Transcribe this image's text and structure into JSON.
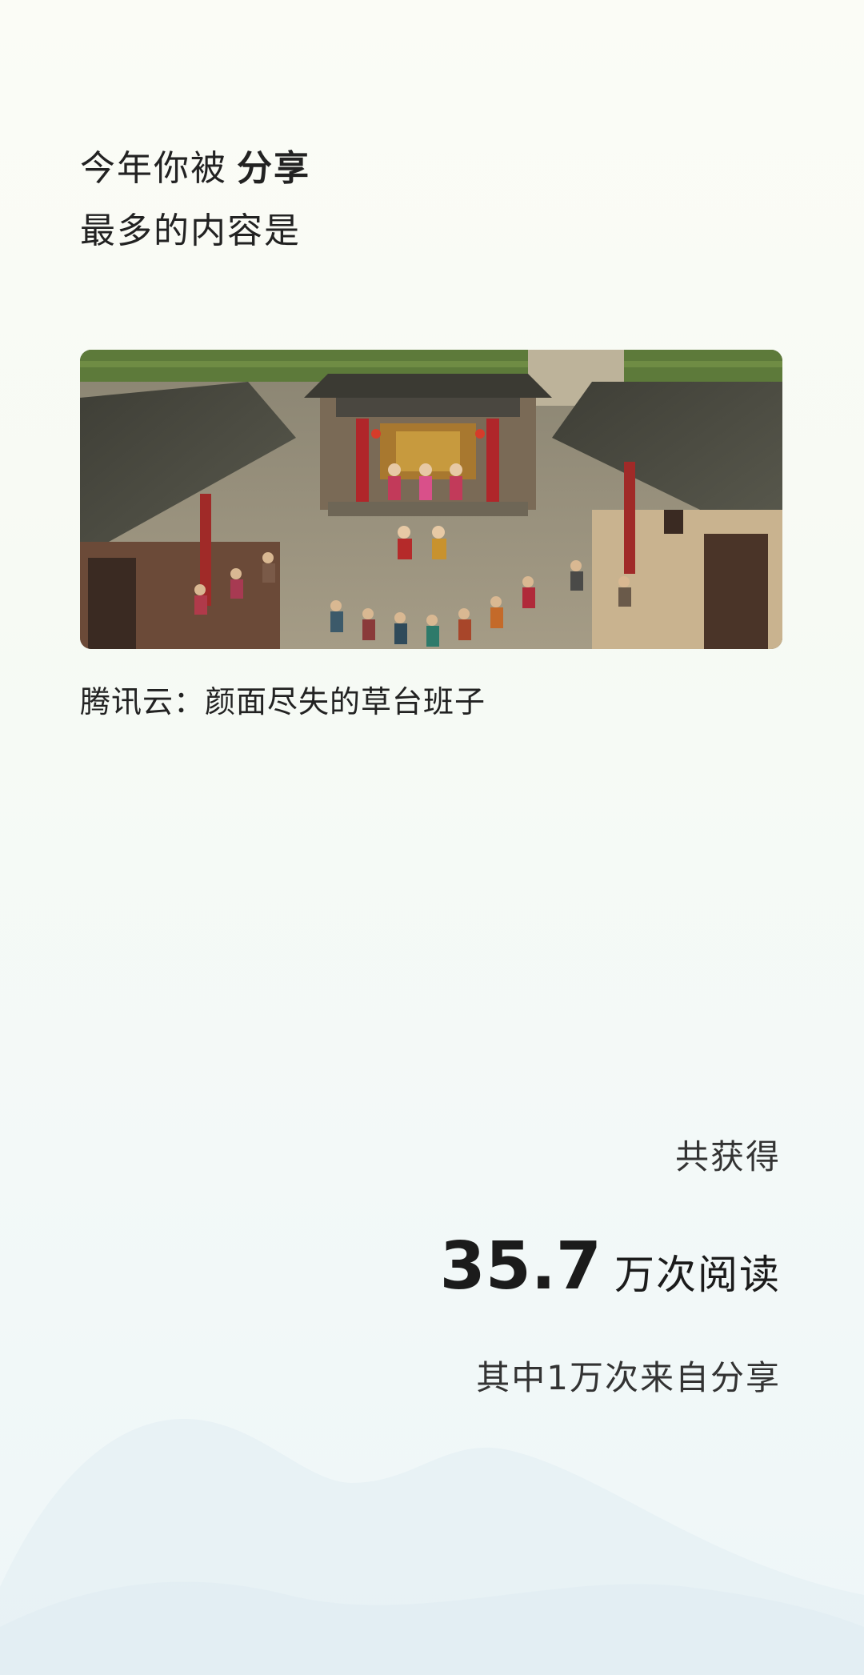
{
  "heading": {
    "line1_prefix": "今年你被",
    "line1_strong": "分享",
    "line2": "最多的内容是"
  },
  "content": {
    "image_alt": "Chinese village courtyard opera stage with costumed performers and seated audience",
    "caption": "腾讯云：颜面尽失的草台班子"
  },
  "stats": {
    "label": "共获得",
    "reads_number": "35.7",
    "reads_unit": "万次阅读",
    "share_note": "其中1万次来自分享"
  },
  "colors": {
    "background_top": "#fbfcf6",
    "background_bottom": "#eef6f8",
    "text": "#1f1f1f"
  }
}
